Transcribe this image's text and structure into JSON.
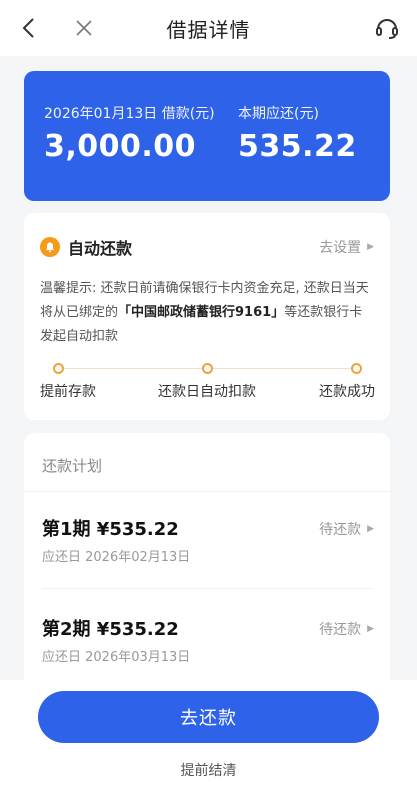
{
  "nav": {
    "title": "借据详情"
  },
  "loan": {
    "date_label": "2026年01月13日 借款(元)",
    "amount": "3,000.00",
    "due_label": "本期应还(元)",
    "due_amount": "535.22"
  },
  "auto_repay": {
    "title": "自动还款",
    "settings_link": "去设置",
    "tip_prefix": "温馨提示: 还款日前请确保银行卡内资金充足, 还款日当天将从已绑定的",
    "tip_bank": "「中国邮政储蓄银行9161」",
    "tip_suffix": "等还款银行卡发起自动扣款",
    "steps": [
      "提前存款",
      "还款日自动扣款",
      "还款成功"
    ]
  },
  "plan": {
    "title": "还款计划",
    "items": [
      {
        "title": "第1期 ¥535.22",
        "date": "应还日 2026年02月13日",
        "status": "待还款"
      },
      {
        "title": "第2期 ¥535.22",
        "date": "应还日 2026年03月13日",
        "status": "待还款"
      }
    ]
  },
  "actions": {
    "pay": "去还款",
    "early": "提前结清"
  },
  "colors": {
    "primary": "#2e62e8",
    "warning": "#f59a1b"
  }
}
